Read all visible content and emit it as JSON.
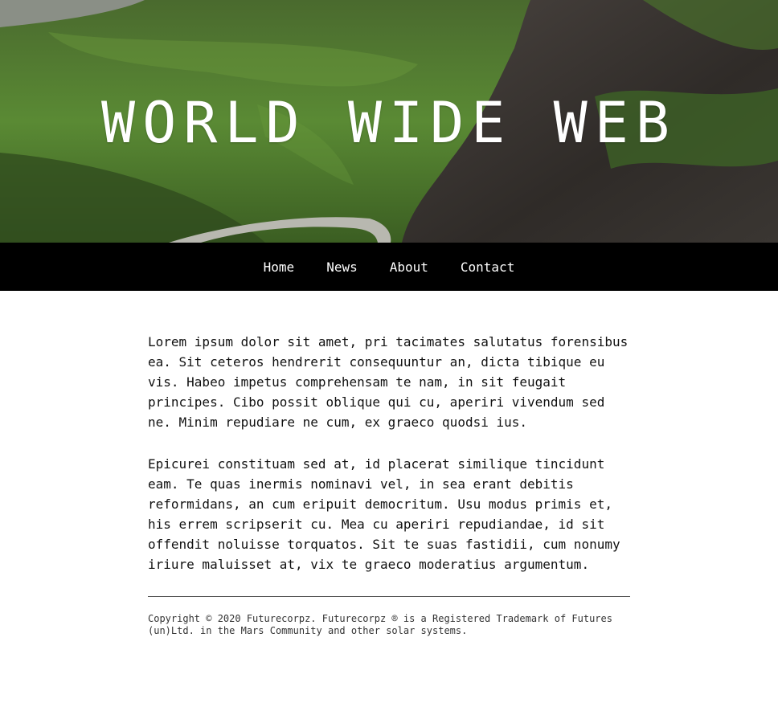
{
  "hero": {
    "title": "WORLD WIDE WEB"
  },
  "nav": {
    "items": [
      {
        "label": "Home"
      },
      {
        "label": "News"
      },
      {
        "label": "About"
      },
      {
        "label": "Contact"
      }
    ]
  },
  "content": {
    "paragraphs": [
      "Lorem ipsum dolor sit amet, pri tacimates salutatus forensibus ea. Sit ceteros hendrerit consequuntur an, dicta tibique eu vis. Habeo impetus comprehensam te nam, in sit feugait principes. Cibo possit oblique qui cu, aperiri vivendum sed ne. Minim repudiare ne cum, ex graeco quodsi ius.",
      "Epicurei constituam sed at, id placerat similique tincidunt eam. Te quas inermis nominavi vel, in sea erant debitis reformidans, an cum eripuit democritum. Usu modus primis et, his errem scripserit cu. Mea cu aperiri repudiandae, id sit offendit noluisse torquatos. Sit te suas fastidii, cum nonumy iriure maluisset at, vix te graeco moderatius argumentum."
    ]
  },
  "footer": {
    "text": "Copyright © 2020 Futurecorpz. Futurecorpz ® is a Registered Trademark of Futures (un)Ltd. in the Mars Community and other solar systems."
  },
  "colors": {
    "nav_background": "#000000",
    "nav_text": "#ffffff",
    "hero_grass": "#4f7a30",
    "hero_rock": "#3a3632"
  }
}
